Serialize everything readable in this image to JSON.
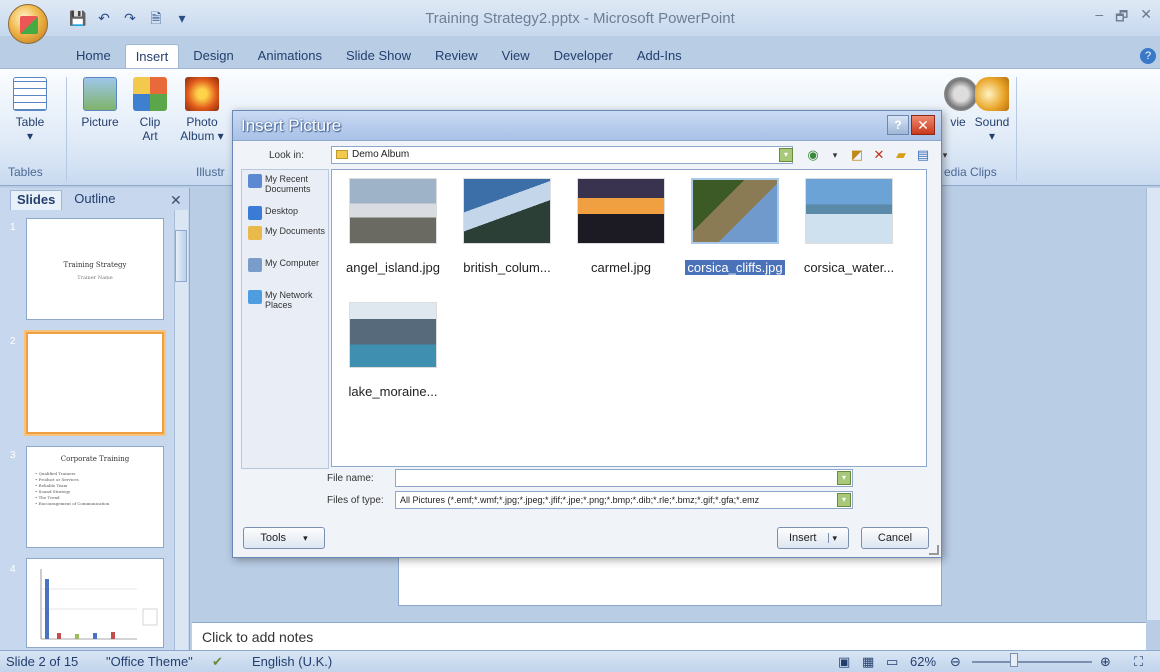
{
  "window": {
    "title": "Training Strategy2.pptx - Microsoft PowerPoint",
    "controls": [
      "–",
      "🗗",
      "✕"
    ]
  },
  "quick_access": {
    "items": [
      "💾",
      "↶",
      "↷",
      "🗎",
      "▾"
    ]
  },
  "ribbon_tabs": [
    "Home",
    "Insert",
    "Design",
    "Animations",
    "Slide Show",
    "Review",
    "View",
    "Developer",
    "Add-Ins"
  ],
  "active_tab": "Insert",
  "ribbon": {
    "table": "Table",
    "picture": "Picture",
    "clip_art_l1": "Clip",
    "clip_art_l2": "Art",
    "photo_album_l1": "Photo",
    "photo_album_l2": "Album",
    "photo_album_arrow": "▾",
    "movie": "vie",
    "sound": "Sound",
    "group_tables": "Tables",
    "group_illustrations": "Illustr",
    "group_media": "edia Clips"
  },
  "slides_pane": {
    "tab_slides": "Slides",
    "tab_outline": "Outline",
    "close": "✕",
    "slides": [
      {
        "num": "1",
        "title": "Training Strategy",
        "sub": "Trainer Name"
      },
      {
        "num": "2",
        "title": "",
        "sub": ""
      },
      {
        "num": "3",
        "title": "Corporate Training",
        "bullets": [
          "Qualified Trainers",
          "Product or Services",
          "Reliable Team",
          "Sound Strategy",
          "The Trend",
          "Encouragement of Communication"
        ]
      },
      {
        "num": "4",
        "title": "",
        "sub": ""
      }
    ]
  },
  "notes": {
    "placeholder": "Click to add notes"
  },
  "status": {
    "slide": "Slide 2 of 15",
    "theme": "\"Office Theme\"",
    "language": "English (U.K.)",
    "zoom": "62%"
  },
  "dialog": {
    "title": "Insert Picture",
    "help": "?",
    "close": "✕",
    "look_in_label": "Look in:",
    "look_in_value": "Demo Album",
    "places": [
      {
        "label": "My Recent Documents",
        "color": "#5c8ad0"
      },
      {
        "label": "Desktop",
        "color": "#3a7bd5"
      },
      {
        "label": "My Documents",
        "color": "#e9b949"
      },
      {
        "label": "My Computer",
        "color": "#7a9cc8"
      },
      {
        "label": "My Network Places",
        "color": "#4d9de0"
      }
    ],
    "files": [
      {
        "name": "angel_island.jpg",
        "colors": [
          "#9fb3c8",
          "#d9dde2",
          "#6a6a62"
        ],
        "selected": false
      },
      {
        "name": "british_colum...",
        "colors": [
          "#3c6fa8",
          "#c3d6ea",
          "#2c3f36"
        ],
        "selected": false
      },
      {
        "name": "carmel.jpg",
        "colors": [
          "#f0a040",
          "#3a3350",
          "#1c1a22"
        ],
        "selected": false
      },
      {
        "name": "corsica_cliffs.jpg",
        "colors": [
          "#6f9acb",
          "#8b7b55",
          "#3c5a26"
        ],
        "selected": true
      },
      {
        "name": "corsica_water...",
        "colors": [
          "#6ba3d6",
          "#5b8aa8",
          "#cfe0ee"
        ],
        "selected": false
      },
      {
        "name": "lake_moraine...",
        "colors": [
          "#dfe7ef",
          "#576a7c",
          "#3f8fb0"
        ],
        "selected": false
      }
    ],
    "file_name_label": "File name:",
    "file_name_value": "",
    "files_of_type_label": "Files of type:",
    "files_of_type_value": "All Pictures (*.emf;*.wmf;*.jpg;*.jpeg;*.jfif;*.jpe;*.png;*.bmp;*.dib;*.rle;*.bmz;*.gif;*.gfa;*.emz",
    "tools_label": "Tools",
    "insert_label": "Insert",
    "cancel_label": "Cancel",
    "dropdown_arrow": "▾"
  }
}
